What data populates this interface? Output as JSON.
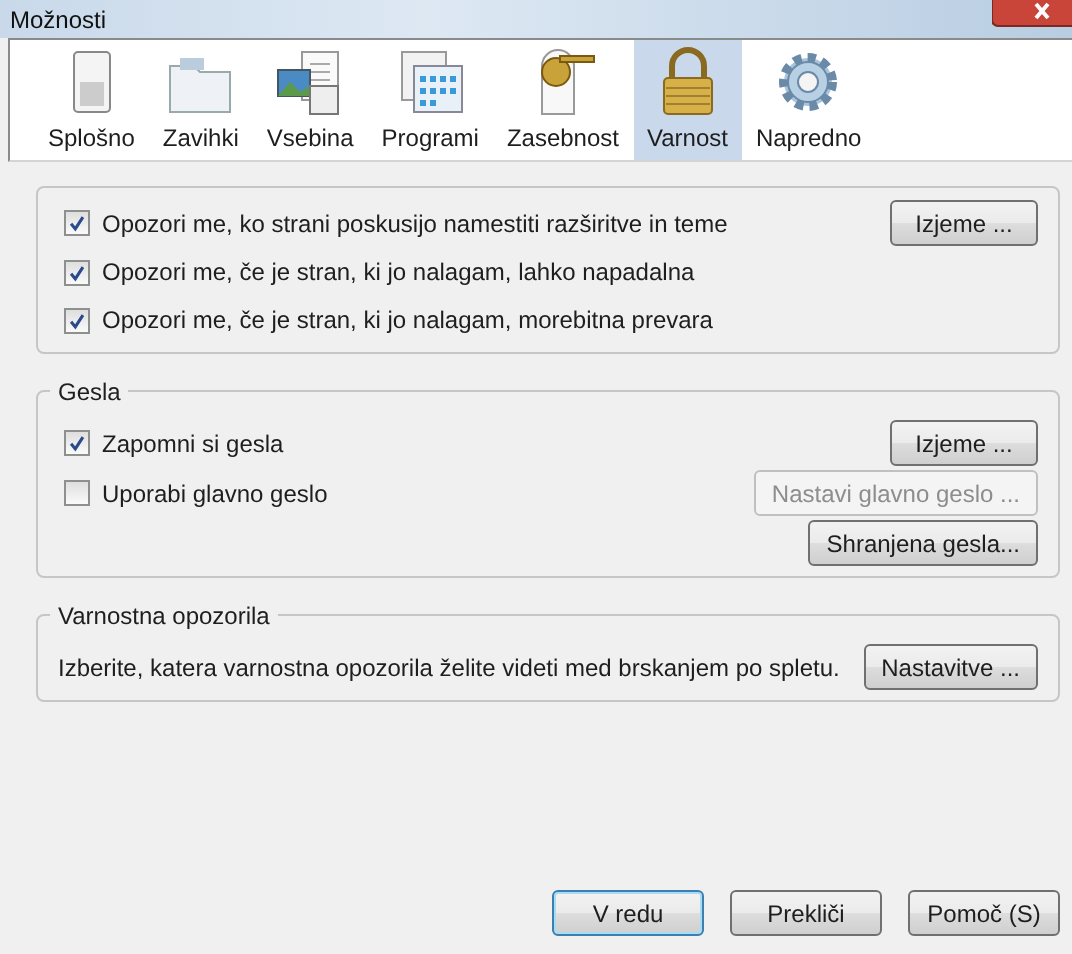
{
  "window": {
    "title": "Možnosti"
  },
  "tabs": [
    {
      "label": "Splošno",
      "kind": "switch",
      "selected": false
    },
    {
      "label": "Zavihki",
      "kind": "folder",
      "selected": false
    },
    {
      "label": "Vsebina",
      "kind": "content",
      "selected": false
    },
    {
      "label": "Programi",
      "kind": "apps",
      "selected": false
    },
    {
      "label": "Zasebnost",
      "kind": "key",
      "selected": false
    },
    {
      "label": "Varnost",
      "kind": "lock",
      "selected": true
    },
    {
      "label": "Napredno",
      "kind": "gear",
      "selected": false
    }
  ],
  "groups": [
    {
      "rows": [
        {
          "kind": "checkbox",
          "label": "Opozori me, ko strani poskusijo namestiti razširitve in teme",
          "checked": true,
          "button": {
            "label": "Izjeme ...",
            "disabled": false
          }
        },
        {
          "kind": "checkbox",
          "label": "Opozori me, če je stran, ki jo nalagam, lahko napadalna",
          "checked": true
        },
        {
          "kind": "checkbox",
          "label": "Opozori me, če je stran, ki jo nalagam, morebitna prevara",
          "checked": true
        }
      ]
    },
    {
      "title": "Gesla",
      "rows": [
        {
          "kind": "checkbox",
          "label": "Zapomni si gesla",
          "checked": true,
          "button": {
            "label": "Izjeme ...",
            "disabled": false
          }
        },
        {
          "kind": "checkbox",
          "label": "Uporabi glavno geslo",
          "checked": false,
          "button": {
            "label": "Nastavi glavno geslo ...",
            "disabled": true
          }
        },
        {
          "kind": "button",
          "button": {
            "label": "Shranjena gesla...",
            "disabled": false
          }
        }
      ]
    },
    {
      "title": "Varnostna opozorila",
      "rows": [
        {
          "kind": "text",
          "label": "Izberite, katera varnostna opozorila želite videti med brskanjem po spletu.",
          "button": {
            "label": "Nastavitve ...",
            "disabled": false
          }
        }
      ]
    }
  ],
  "buttons": [
    {
      "label": "V redu",
      "default": true
    },
    {
      "label": "Prekliči",
      "default": false
    },
    {
      "label": "Pomoč (S)",
      "default": false
    }
  ]
}
